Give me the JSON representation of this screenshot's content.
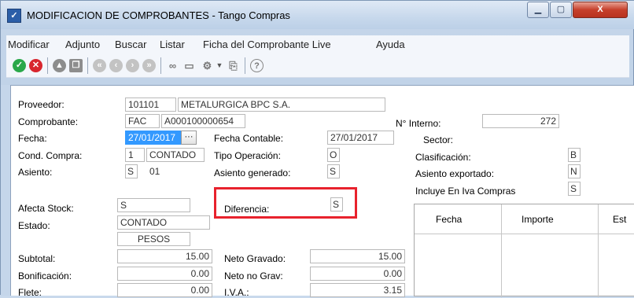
{
  "window": {
    "title": "MODIFICACION DE COMPROBANTES - Tango Compras",
    "close_glyph": "X",
    "min_glyph": "▁",
    "max_glyph": "▢"
  },
  "menu": [
    "Modificar",
    "Adjunto",
    "Buscar",
    "Listar",
    "Ficha del Comprobante Live",
    "Ayuda"
  ],
  "toolbar": {
    "icons": [
      "accept-icon",
      "cancel-icon",
      "up-icon",
      "copy-icon",
      "first-icon",
      "previous-icon",
      "next-icon",
      "last-icon",
      "binoculars-icon",
      "monitor-icon",
      "settings-icon",
      "dropdown-arrow-icon",
      "document-icon",
      "help-icon"
    ]
  },
  "form": {
    "proveedor_label": "Proveedor:",
    "proveedor_code": "101101",
    "proveedor_name": "METALURGICA BPC S.A.",
    "comprobante_label": "Comprobante:",
    "comprobante_type": "FAC",
    "comprobante_number": "A000100000654",
    "nro_interno_label": "N° Interno:",
    "nro_interno": "272",
    "fecha_label": "Fecha:",
    "fecha": "27/01/2017",
    "fecha_contable_label": "Fecha Contable:",
    "fecha_contable": "27/01/2017",
    "sector_label": "Sector:",
    "cond_compra_label": "Cond. Compra:",
    "cond_compra_code": "1",
    "cond_compra_desc": "CONTADO",
    "tipo_operacion_label": "Tipo Operación:",
    "tipo_operacion": "O",
    "clasificacion_label": "Clasificación:",
    "clasificacion": "B",
    "asiento_label": "Asiento:",
    "asiento_flag": "S",
    "asiento_value": "01",
    "asiento_generado_label": "Asiento generado:",
    "asiento_generado": "S",
    "asiento_exportado_label": "Asiento exportado:",
    "asiento_exportado": "N",
    "incluye_iva_label": "Incluye En Iva Compras",
    "incluye_iva": "S",
    "afecta_stock_label": "Afecta Stock:",
    "afecta_stock": "S",
    "diferencia_label": "Diferencia:",
    "diferencia": "S",
    "estado_label": "Estado:",
    "estado": "CONTADO",
    "moneda": "PESOS",
    "subtotal_label": "Subtotal:",
    "subtotal": "15.00",
    "neto_gravado_label": "Neto Gravado:",
    "neto_gravado": "15.00",
    "bonificacion_label": "Bonificación:",
    "bonificacion": "0.00",
    "neto_no_grav_label": "Neto no Grav:",
    "neto_no_grav": "0.00",
    "flete_label": "Flete:",
    "flete": "0.00",
    "iva_label": "I.V.A.:",
    "iva": "3.15"
  },
  "grid": {
    "columns": [
      "Fecha",
      "Importe",
      "Est"
    ]
  }
}
